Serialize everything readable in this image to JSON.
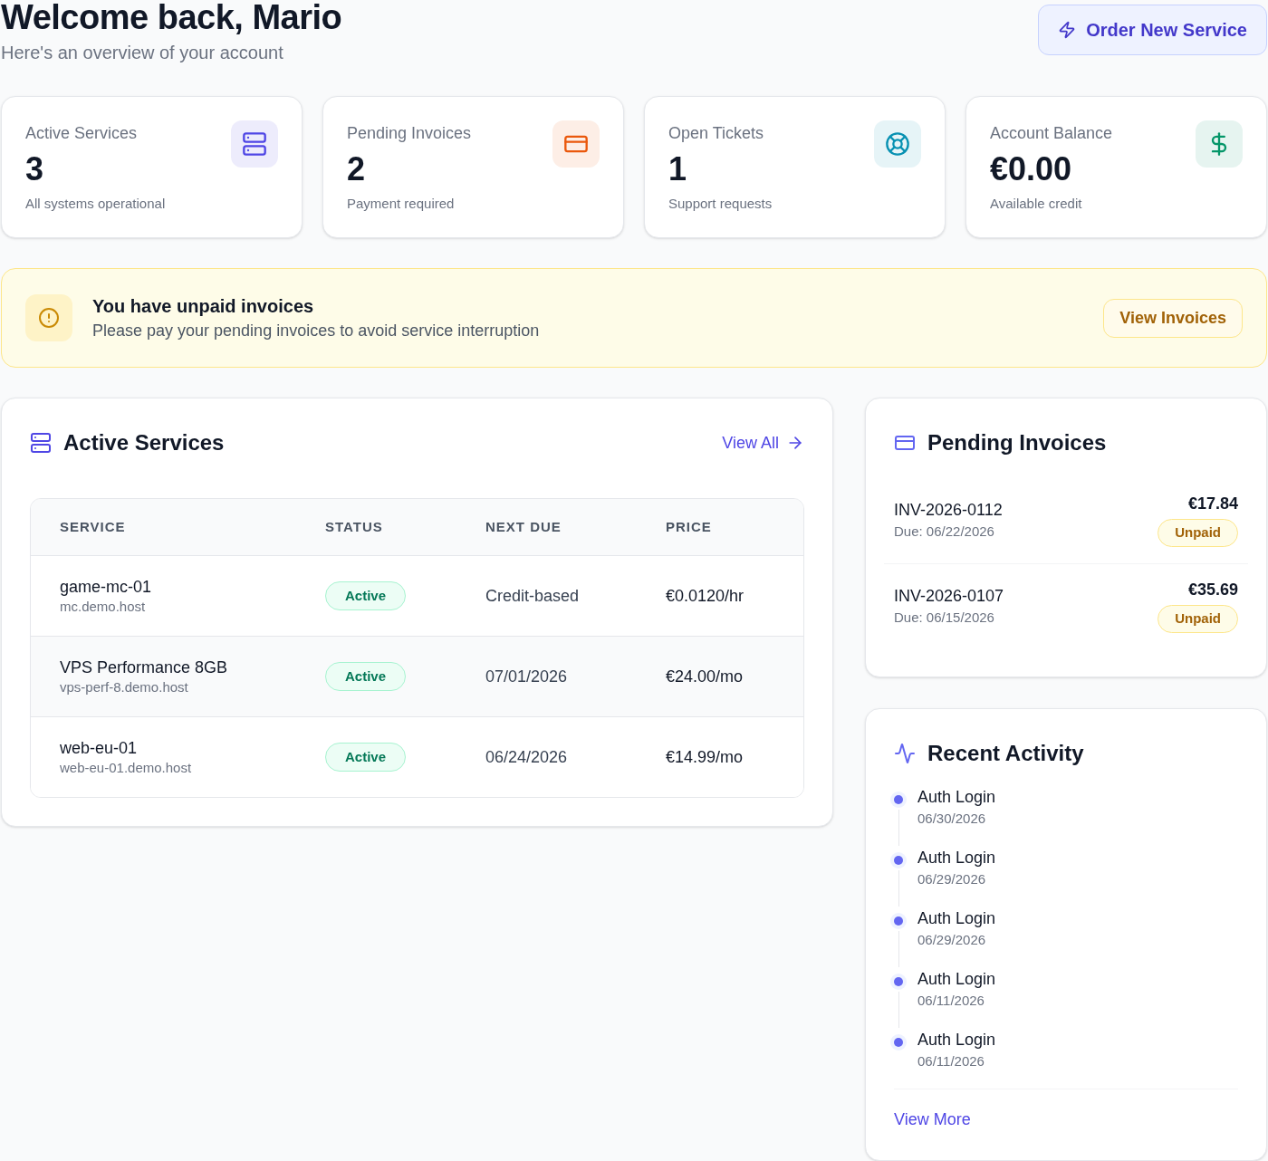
{
  "header": {
    "title": "Welcome back, Mario",
    "subtitle": "Here's an overview of your account",
    "action": "Order New Service"
  },
  "stats": [
    {
      "kind": "services",
      "label": "Active Services",
      "value": "3",
      "note": "All systems operational",
      "color": "#4f46e5"
    },
    {
      "kind": "invoices",
      "label": "Pending Invoices",
      "value": "2",
      "note": "Payment required",
      "color": "#ea580c"
    },
    {
      "kind": "tickets",
      "label": "Open Tickets",
      "value": "1",
      "note": "Support requests",
      "color": "#0891b2"
    },
    {
      "kind": "balance",
      "label": "Account Balance",
      "value": "€0.00",
      "note": "Available credit",
      "color": "#059669"
    }
  ],
  "alert": {
    "title": "You have unpaid invoices",
    "message": "Please pay your pending invoices to avoid service interruption",
    "action": "View Invoices"
  },
  "services": {
    "title": "Active Services",
    "link": "View All",
    "columns": [
      "SERVICE",
      "STATUS",
      "NEXT DUE",
      "PRICE"
    ],
    "rows": [
      {
        "name": "game-mc-01",
        "host": "mc.demo.host",
        "status": "Active",
        "next_due": "Credit-based",
        "price": "€0.0120/hr"
      },
      {
        "name": "VPS Performance 8GB",
        "host": "vps-perf-8.demo.host",
        "status": "Active",
        "next_due": "07/01/2026",
        "price": "€24.00/mo"
      },
      {
        "name": "web-eu-01",
        "host": "web-eu-01.demo.host",
        "status": "Active",
        "next_due": "06/24/2026",
        "price": "€14.99/mo"
      }
    ]
  },
  "invoices": {
    "title": "Pending Invoices",
    "items": [
      {
        "number": "INV-2026-0112",
        "due": "Due: 06/22/2026",
        "amount": "€17.84",
        "status": "Unpaid"
      },
      {
        "number": "INV-2026-0107",
        "due": "Due: 06/15/2026",
        "amount": "€35.69",
        "status": "Unpaid"
      }
    ]
  },
  "activity": {
    "title": "Recent Activity",
    "items": [
      {
        "event": "Auth Login",
        "date": "06/30/2026"
      },
      {
        "event": "Auth Login",
        "date": "06/29/2026"
      },
      {
        "event": "Auth Login",
        "date": "06/29/2026"
      },
      {
        "event": "Auth Login",
        "date": "06/11/2026"
      },
      {
        "event": "Auth Login",
        "date": "06/11/2026"
      }
    ],
    "link": "View More"
  }
}
